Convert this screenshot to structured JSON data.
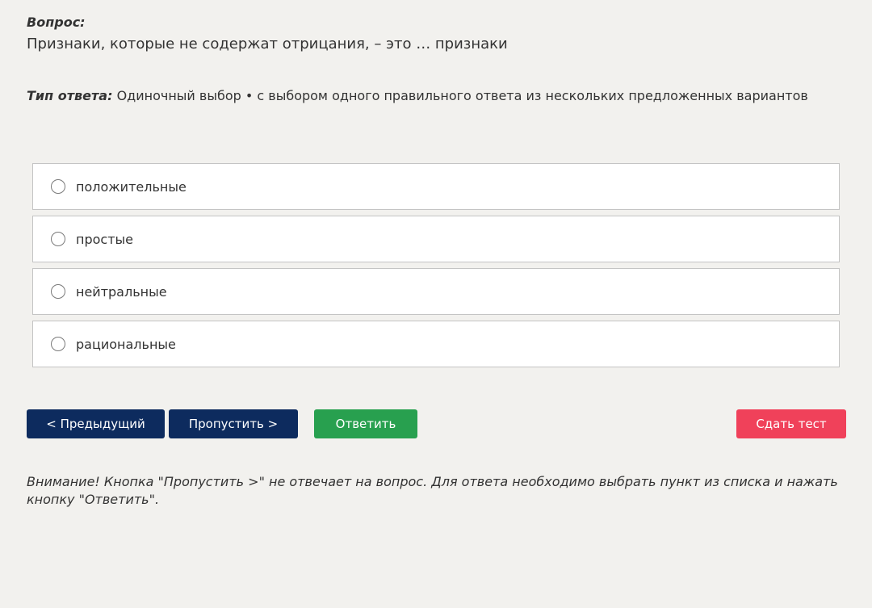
{
  "question": {
    "label": "Вопрос:",
    "text": "Признаки, которые не содержат отрицания, – это … признаки"
  },
  "answer_type": {
    "label": "Тип ответа:",
    "value": "Одиночный выбор • с выбором одного правильного ответа из нескольких предложенных вариантов"
  },
  "options": [
    {
      "label": "положительные",
      "selected": false
    },
    {
      "label": "простые",
      "selected": false
    },
    {
      "label": "нейтральные",
      "selected": false
    },
    {
      "label": "рациональные",
      "selected": false
    }
  ],
  "buttons": {
    "prev": "< Предыдущий",
    "skip": "Пропустить >",
    "answer": "Ответить",
    "submit": "Сдать тест"
  },
  "colors": {
    "nav_button": "#0d2b5e",
    "answer_button": "#28a04f",
    "submit_button": "#f0415a",
    "background": "#f2f1ee"
  },
  "warning": "Внимание! Кнопка \"Пропустить >\" не отвечает на вопрос. Для ответа необходимо выбрать пункт из списка и нажать кнопку \"Ответить\"."
}
